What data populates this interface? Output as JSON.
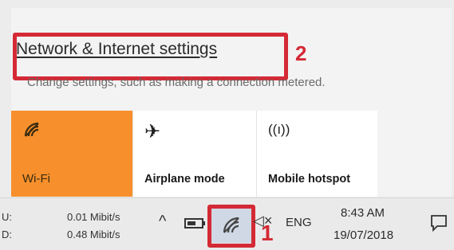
{
  "flyout": {
    "settings_link": "Network & Internet settings",
    "description": "Change settings, such as making a connection metered.",
    "annotation_2": "2"
  },
  "tiles": [
    {
      "label": "Wi-Fi",
      "icon": "wifi-signal-icon",
      "active": true
    },
    {
      "label": "Airplane mode",
      "icon": "airplane-icon",
      "active": false
    },
    {
      "label": "Mobile hotspot",
      "icon": "hotspot-icon",
      "active": false
    }
  ],
  "taskbar": {
    "upload_label": "U:",
    "download_label": "D:",
    "upload_speed": "0.01 Mibit/s",
    "download_speed": "0.48 Mibit/s",
    "language": "ENG",
    "time": "8:43 AM",
    "date": "19/07/2018",
    "annotation_1": "1"
  },
  "colors": {
    "accent": "#f7902c",
    "highlight": "#d42a35"
  }
}
